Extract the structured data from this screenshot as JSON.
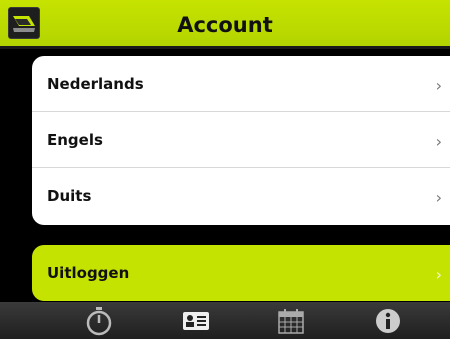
{
  "header": {
    "title": "Account",
    "logo_icon": "app-logo-icon"
  },
  "languages": [
    {
      "label": "Nederlands"
    },
    {
      "label": "Engels"
    },
    {
      "label": "Duits"
    }
  ],
  "logout": {
    "label": "Uitloggen"
  },
  "chevron": "›",
  "tabbar": {
    "items": [
      {
        "icon": "stopwatch-icon"
      },
      {
        "icon": "contact-card-icon"
      },
      {
        "icon": "calendar-icon"
      },
      {
        "icon": "info-icon"
      }
    ]
  },
  "colors": {
    "accent": "#c5e300",
    "background": "#000000",
    "list_bg": "#ffffff"
  }
}
